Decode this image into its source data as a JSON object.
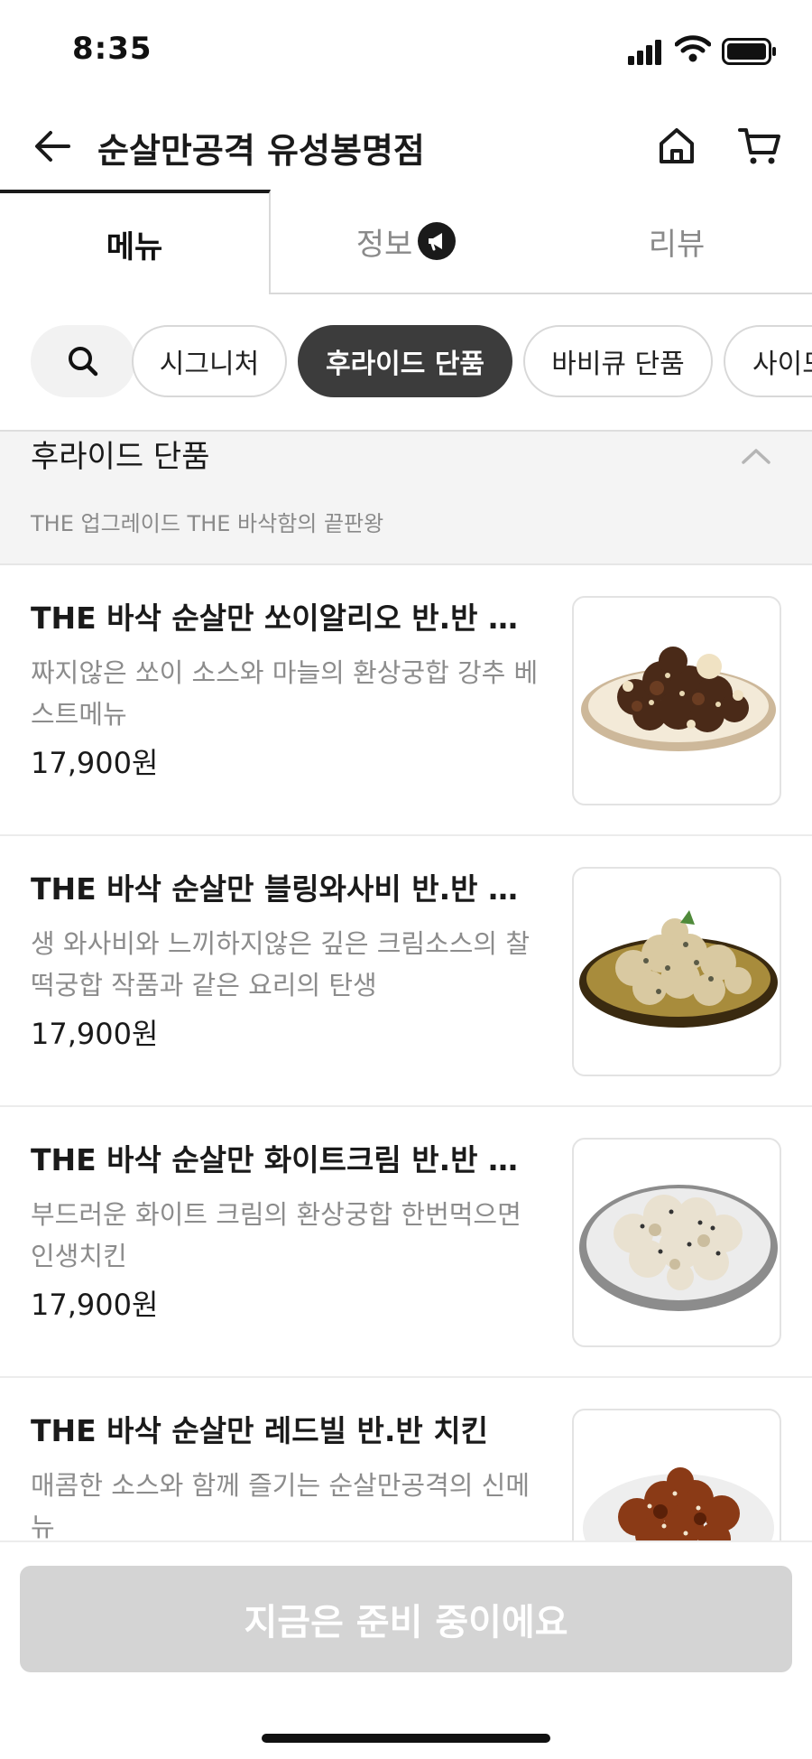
{
  "status_bar": {
    "time": "8:35"
  },
  "header": {
    "store_name": "순살만공격 유성봉명점"
  },
  "tabs": [
    {
      "label": "메뉴",
      "active": true
    },
    {
      "label": "정보",
      "active": false
    },
    {
      "label": "리뷰",
      "active": false
    }
  ],
  "categories": [
    {
      "label": "시그니처",
      "active": false
    },
    {
      "label": "후라이드 단품",
      "active": true
    },
    {
      "label": "바비큐 단품",
      "active": false
    },
    {
      "label": "사이드",
      "active": false
    }
  ],
  "section": {
    "title": "후라이드 단품",
    "description": "THE 업그레이드 THE 바삭함의 끝판왕"
  },
  "items": [
    {
      "name": "THE 바삭 순살만 쏘이알리오 반.반 치킨",
      "description": "짜지않은 쏘이 소스와 마늘의 환상궁합 강추 베스트메뉴",
      "price": "17,900원"
    },
    {
      "name": "THE 바삭 순살만 블링와사비 반.반 치킨",
      "description": "생 와사비와 느끼하지않은 깊은 크림소스의 찰떡궁합 작품과 같은 요리의 탄생",
      "price": "17,900원"
    },
    {
      "name": "THE 바삭 순살만 화이트크림 반.반 치킨",
      "description": "부드러운 화이트 크림의 환상궁합 한번먹으면 인생치킨",
      "price": "17,900원"
    },
    {
      "name": "THE 바삭 순살만 레드빌 반.반 치킨",
      "description": "매콤한 소스와 함께 즐기는 순살만공격의 신메뉴",
      "price": ""
    }
  ],
  "cta": {
    "label": "지금은 준비 중이에요",
    "enabled": false
  },
  "colors": {
    "chip_active": "#3c3c3c",
    "cta_disabled": "#d4d4d4",
    "muted_text": "#8c8c8c"
  }
}
